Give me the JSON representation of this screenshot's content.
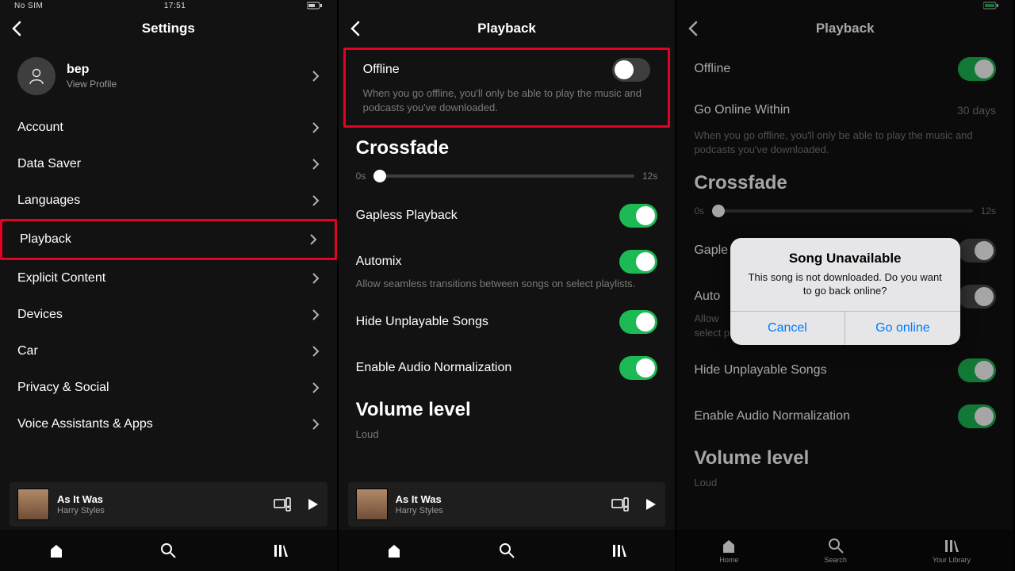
{
  "statusbar": {
    "carrier": "No SIM",
    "time": "17:51",
    "battery_icon": "battery-icon"
  },
  "screens": {
    "s1": {
      "title": "Settings",
      "profile": {
        "name": "bep",
        "sub": "View Profile"
      },
      "rows": [
        {
          "label": "Account"
        },
        {
          "label": "Data Saver"
        },
        {
          "label": "Languages"
        },
        {
          "label": "Playback",
          "highlight": true
        },
        {
          "label": "Explicit Content"
        },
        {
          "label": "Devices"
        },
        {
          "label": "Car"
        },
        {
          "label": "Privacy & Social"
        },
        {
          "label": "Voice Assistants & Apps"
        }
      ]
    },
    "s2": {
      "title": "Playback",
      "offline": {
        "label": "Offline",
        "state": "off",
        "desc": "When you go offline, you'll only be able to play the music and podcasts you've downloaded."
      },
      "crossfade": {
        "heading": "Crossfade",
        "min": "0s",
        "max": "12s",
        "value": 0
      },
      "toggles": [
        {
          "label": "Gapless Playback",
          "state": "on"
        },
        {
          "label": "Automix",
          "state": "on",
          "desc": "Allow seamless transitions between songs on select playlists."
        },
        {
          "label": "Hide Unplayable Songs",
          "state": "on"
        },
        {
          "label": "Enable Audio Normalization",
          "state": "on"
        }
      ],
      "volume": {
        "heading": "Volume level",
        "sub": "Loud"
      }
    },
    "s3": {
      "title": "Playback",
      "offline": {
        "label": "Offline",
        "state": "on"
      },
      "go_online": {
        "label": "Go Online Within",
        "value": "30 days"
      },
      "desc": "When you go offline, you'll only be able to play the music and podcasts you've downloaded.",
      "crossfade": {
        "heading": "Crossfade",
        "min": "0s",
        "max": "12s",
        "value": 0
      },
      "toggles": [
        {
          "label_a": "Gaple",
          "state": "gray-on"
        },
        {
          "label_a": "Auto",
          "state": "gray-on"
        },
        {
          "desc": "Allow",
          "desc2": "select pl"
        },
        {
          "label": "Hide Unplayable Songs",
          "state": "on"
        },
        {
          "label": "Enable Audio Normalization",
          "state": "on"
        }
      ],
      "volume": {
        "heading": "Volume level",
        "sub": "Loud"
      },
      "dialog": {
        "title": "Song Unavailable",
        "message": "This song is not downloaded. Do you want to go back online?",
        "cancel": "Cancel",
        "confirm": "Go online"
      }
    }
  },
  "now_playing": {
    "song": "As It Was",
    "artist": "Harry Styles"
  },
  "nav": {
    "home": "Home",
    "search": "Search",
    "library": "Your Library"
  },
  "colors": {
    "accent": "#1db954",
    "highlight": "#e60023",
    "ios_blue": "#007aff"
  }
}
